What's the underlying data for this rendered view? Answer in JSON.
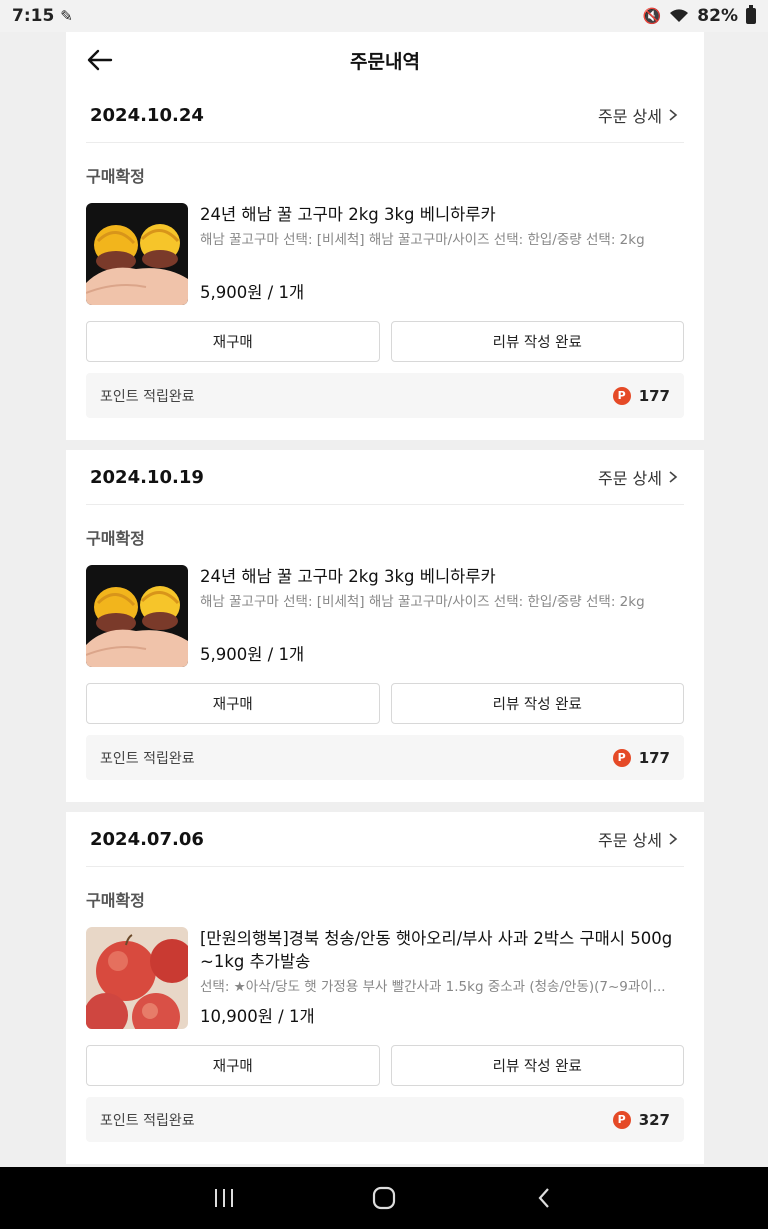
{
  "statusbar": {
    "time": "7:15",
    "battery": "82%"
  },
  "header": {
    "title": "주문내역"
  },
  "orders": [
    {
      "date": "2024.10.24",
      "detail_label": "주문 상세",
      "status": "구매확정",
      "product_name": "24년 해남 꿀 고구마 2kg 3kg 베니하루카",
      "product_option": "해남 꿀고구마 선택: [비세척] 해남 꿀고구마/사이즈 선택: 한입/중량 선택: 2kg",
      "price": "5,900원 / 1개",
      "rebuy_label": "재구매",
      "review_label": "리뷰 작성 완료",
      "points_label": "포인트 적립완료",
      "points_value": "177",
      "thumb": "sweet-potato"
    },
    {
      "date": "2024.10.19",
      "detail_label": "주문 상세",
      "status": "구매확정",
      "product_name": "24년 해남 꿀 고구마 2kg 3kg 베니하루카",
      "product_option": "해남 꿀고구마 선택: [비세척] 해남 꿀고구마/사이즈 선택: 한입/중량 선택: 2kg",
      "price": "5,900원 / 1개",
      "rebuy_label": "재구매",
      "review_label": "리뷰 작성 완료",
      "points_label": "포인트 적립완료",
      "points_value": "177",
      "thumb": "sweet-potato"
    },
    {
      "date": "2024.07.06",
      "detail_label": "주문 상세",
      "status": "구매확정",
      "product_name": "[만원의행복]경북 청송/안동 햇아오리/부사 사과 2박스 구매시 500g ~1kg 추가발송",
      "product_option": "선택: ★아삭/당도 햇 가정용 부사 빨간사과 1.5kg 중소과 (청송/안동)(7~9과이...",
      "price": "10,900원 / 1개",
      "rebuy_label": "재구매",
      "review_label": "리뷰 작성 완료",
      "points_label": "포인트 적립완료",
      "points_value": "327",
      "thumb": "apple"
    }
  ],
  "colors": {
    "points_badge": "#e54a27",
    "background": "#efefef"
  }
}
